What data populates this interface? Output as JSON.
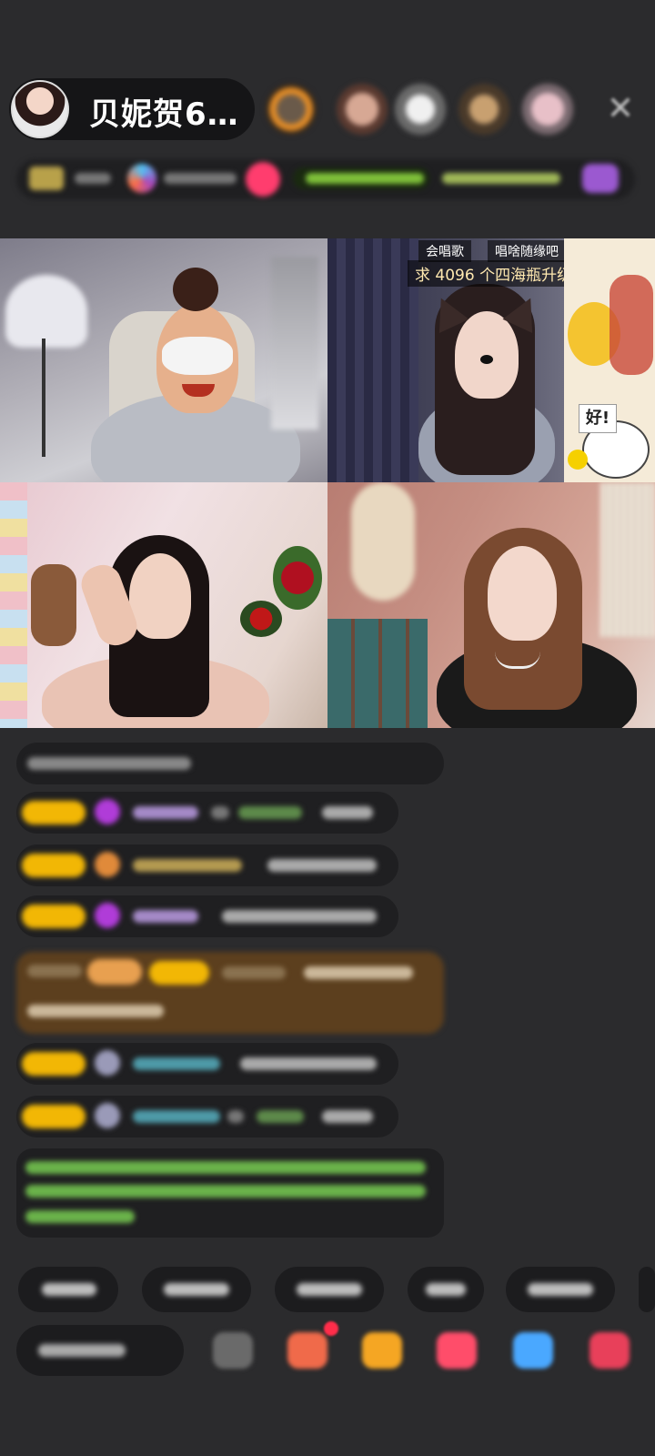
{
  "header": {
    "host_name": "贝妮贺6…",
    "close_icon": "close-icon"
  },
  "video": {
    "overlay_line1_a": "会唱歌",
    "overlay_line1_b": "唱啥随缘吧",
    "overlay_line2": "求 4096 个四海瓶升级~~",
    "sticker_text": "好!"
  },
  "colors": {
    "badge": "#f2b705",
    "chat_bg": "#1f1f21",
    "gift_bg": "#5c3f1e",
    "system_text": "#6bb34a"
  }
}
